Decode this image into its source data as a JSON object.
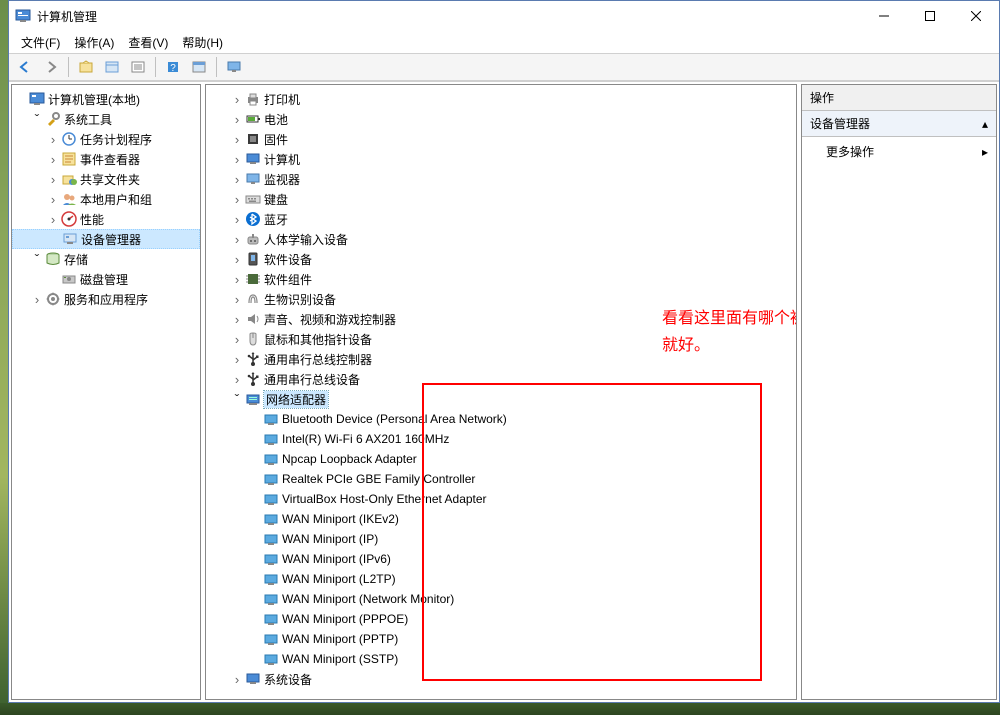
{
  "window": {
    "title": "计算机管理"
  },
  "menu": {
    "file": "文件(F)",
    "action": "操作(A)",
    "view": "查看(V)",
    "help": "帮助(H)"
  },
  "left_tree": {
    "root": "计算机管理(本地)",
    "system_tools": "系统工具",
    "task_scheduler": "任务计划程序",
    "event_viewer": "事件查看器",
    "shared_folders": "共享文件夹",
    "local_users": "本地用户和组",
    "performance": "性能",
    "device_manager": "设备管理器",
    "storage": "存储",
    "disk_mgmt": "磁盘管理",
    "services_apps": "服务和应用程序"
  },
  "mid_tree": {
    "printers": "打印机",
    "batteries": "电池",
    "firmware": "固件",
    "computer": "计算机",
    "monitors": "监视器",
    "keyboards": "键盘",
    "bluetooth": "蓝牙",
    "hid": "人体学输入设备",
    "soft_devices": "软件设备",
    "soft_components": "软件组件",
    "biometric": "生物识别设备",
    "sound": "声音、视频和游戏控制器",
    "mice": "鼠标和其他指针设备",
    "usb_controllers": "通用串行总线控制器",
    "usb_devices": "通用串行总线设备",
    "network_adapters": "网络适配器",
    "na_items": [
      "Bluetooth Device (Personal Area Network)",
      "Intel(R) Wi-Fi 6 AX201 160MHz",
      "Npcap Loopback Adapter",
      "Realtek PCIe GBE Family Controller",
      "VirtualBox Host-Only Ethernet Adapter",
      "WAN Miniport (IKEv2)",
      "WAN Miniport (IP)",
      "WAN Miniport (IPv6)",
      "WAN Miniport (L2TP)",
      "WAN Miniport (Network Monitor)",
      "WAN Miniport (PPPOE)",
      "WAN Miniport (PPTP)",
      "WAN Miniport (SSTP)"
    ],
    "system_devices": "系统设备"
  },
  "actions": {
    "header": "操作",
    "section": "设备管理器",
    "more": "更多操作"
  },
  "annotation": "看看这里面有哪个被禁用了。双击一步步启用就好。"
}
